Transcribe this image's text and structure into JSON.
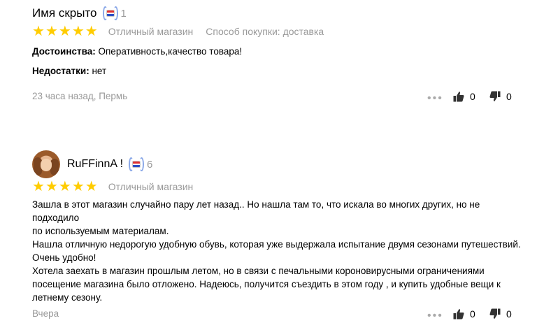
{
  "reviews": [
    {
      "author": "Имя скрыто",
      "badge_count": "1",
      "rating": 5,
      "meta": [
        "Отличный магазин",
        "Способ покупки: доставка"
      ],
      "pros_label": "Достоинства:",
      "pros_text": " Оперативность,качество товара!",
      "cons_label": "Недостатки:",
      "cons_text": " нет",
      "date": "23 часа назад, Пермь",
      "likes": "0",
      "dislikes": "0"
    },
    {
      "author": "RuFFinnA !",
      "badge_count": "6",
      "rating": 5,
      "meta": [
        "Отличный магазин"
      ],
      "text_lines": [
        "Зашла в этот магазин случайно пару лет назад.. Но нашла там то, что искала во многих других, но не подходило",
        "по используемым материалам.",
        "Нашла отличную недорогую удобную обувь, которая уже выдержала испытание двумя сезонами путешествий.",
        "Очень удобно!",
        "Хотела заехать в магазин прошлым летом, но в связи с печальными короновирусными ограничениями",
        "посещение магазина было отложено. Надеюсь, получится съездить в этом году , и купить удобные вещи к",
        "летнему сезону."
      ],
      "date": "Вчера",
      "likes": "0",
      "dislikes": "0"
    }
  ],
  "icons": {
    "star": "star-icon",
    "more": "more-dots-icon",
    "like": "thumb-up-icon",
    "dislike": "thumb-down-icon",
    "badge": "achievement-badge-icon"
  },
  "colors": {
    "star": "#ffcc00",
    "muted": "#999999",
    "text": "#000000"
  }
}
